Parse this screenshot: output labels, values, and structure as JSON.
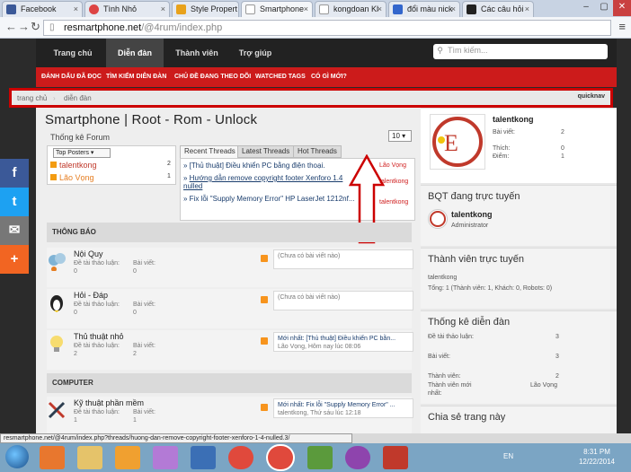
{
  "browser": {
    "tabs": [
      {
        "label": "Facebook",
        "icon": "facebook-icon",
        "color": "#3b5998"
      },
      {
        "label": "Tình Nhỏ",
        "icon": "chrome-icon",
        "color": "#d44"
      },
      {
        "label": "Style Propert",
        "icon": "page-icon",
        "color": "#e8a21c"
      },
      {
        "label": "Smartphone",
        "icon": "page-icon",
        "color": "#999"
      },
      {
        "label": "kongdoan Kl",
        "icon": "page-icon",
        "color": "#999"
      },
      {
        "label": "đổi màu nick",
        "icon": "google-icon",
        "color": "#3366cc"
      },
      {
        "label": "Các câu hỏi",
        "icon": "xf-icon",
        "color": "#222"
      }
    ],
    "url_host": "resmartphone.net",
    "url_path": "/@4rum/index.php",
    "status_url": "resmartphone.net/@4rum/index.php?threads/huong-dan-remove-copyright-footer-xenforo-1-4-nulled.3/"
  },
  "site": {
    "nav": [
      "Trang chủ",
      "Diễn đàn",
      "Thành viên",
      "Trợ giúp"
    ],
    "search_placeholder": "Tìm kiếm...",
    "subnav": [
      "ĐÁNH DẤU ĐÃ ĐỌC",
      "TÌM KIẾM DIỄN ĐÀN",
      "CHỦ ĐỀ ĐANG THEO DÕI",
      "WATCHED TAGS",
      "CÓ GÌ MỚI?"
    ],
    "breadcrumbs": [
      "trang chủ",
      "diễn đàn"
    ],
    "quicknav": "quicknav",
    "title": "Smartphone | Root - Rom - Unlock",
    "forum_stats_label": "Thống kê Forum",
    "per_page": "10",
    "top_posters": {
      "header": "Top Posters",
      "rows": [
        {
          "name": "talentkong",
          "count": "2"
        },
        {
          "name": "Lão Vọng",
          "count": "1"
        }
      ]
    },
    "thread_tabs": [
      "Recent Threads",
      "Latest Threads",
      "Hot Threads"
    ],
    "threads": [
      {
        "title": "[Thủ thuật] Điều khiển PC bằng điện thoại.",
        "by": "Lão Vọng"
      },
      {
        "title": "Hướng dẫn remove copyright footer Xenforo 1.4 nulled",
        "by": "talentkong"
      },
      {
        "title": "Fix lỗi \"Supply Memory Error\" HP LaserJet 1212nf...",
        "by": "talentkong"
      }
    ],
    "categories": [
      {
        "name": "THÔNG BÁO",
        "forums": [
          {
            "name": "Nội Quy",
            "threads_label": "Đề tài thảo luận:",
            "threads": "0",
            "posts_label": "Bài viết:",
            "posts": "0",
            "last": "(Chưa có bài viết nào)",
            "last_by": ""
          },
          {
            "name": "Hỏi - Đáp",
            "threads_label": "Đề tài thảo luận:",
            "threads": "0",
            "posts_label": "Bài viết:",
            "posts": "0",
            "last": "(Chưa có bài viết nào)",
            "last_by": ""
          },
          {
            "name": "Thủ thuật nhỏ",
            "threads_label": "Đề tài thảo luận:",
            "threads": "2",
            "posts_label": "Bài viết:",
            "posts": "2",
            "last": "Mới nhất: [Thủ thuật] Điều khiển PC bằn...",
            "last_by": "Lão Vọng, Hôm nay lúc 08:06"
          }
        ]
      },
      {
        "name": "COMPUTER",
        "forums": [
          {
            "name": "Kỹ thuật phần mềm",
            "threads_label": "Đề tài thảo luận:",
            "threads": "1",
            "posts_label": "Bài viết:",
            "posts": "1",
            "last": "Mới nhất: Fix lỗi \"Supply Memory Error\" ...",
            "last_by": "talentkong, Thứ sáu lúc 12:18"
          }
        ]
      }
    ],
    "sidebar": {
      "user": {
        "name": "talentkong",
        "posts_label": "Bài viết:",
        "posts": "2",
        "likes_label": "Thích:",
        "likes": "0",
        "points_label": "Điểm:",
        "points": "1"
      },
      "staff_title": "BQT đang trực tuyến",
      "staff": {
        "name": "talentkong",
        "role": "Administrator"
      },
      "online_title": "Thành viên trực tuyến",
      "online_user": "talentkong",
      "online_summary": "Tổng: 1 (Thành viên: 1, Khách: 0, Robots: 0)",
      "stats_title": "Thống kê diễn đàn",
      "stats": [
        {
          "label": "Đề tài thảo luận:",
          "value": "3"
        },
        {
          "label": "Bài viết:",
          "value": "3"
        },
        {
          "label": "Thành viên:",
          "value": "2"
        },
        {
          "label": "Thành viên mới nhất:",
          "value": "Lão Vọng"
        }
      ],
      "share_title": "Chia sẻ trang này"
    },
    "share_buttons": [
      "f",
      "t",
      "✉",
      "+"
    ]
  },
  "taskbar": {
    "lang": "EN",
    "time": "8:31 PM",
    "date": "12/22/2014"
  },
  "colors": {
    "accent_red": "#cc1b1b",
    "link_blue": "#1a3d6d",
    "facebook": "#3b5998",
    "twitter": "#1da1f2"
  }
}
